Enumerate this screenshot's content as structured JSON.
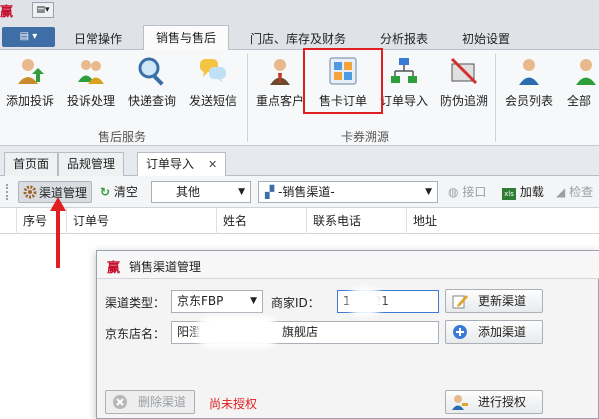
{
  "app": {
    "logo_text": "赢",
    "qat_glyph": "▤▾"
  },
  "ribbon_tabs": [
    "日常操作",
    "销售与售后",
    "门店、库存及财务",
    "分析报表",
    "初始设置"
  ],
  "ribbon_tab_active": "销售与售后",
  "ribbon": {
    "after_sales": {
      "caption": "售后服务",
      "buttons": [
        "添加投诉",
        "投诉处理",
        "快递查询",
        "发送短信"
      ]
    },
    "coupon": {
      "caption": "卡券溯源",
      "buttons": [
        "重点客户",
        "售卡订单",
        "订单导入",
        "防伪追溯"
      ]
    },
    "members": {
      "buttons": [
        "会员列表",
        "全部"
      ]
    }
  },
  "doc_tabs": {
    "items": [
      "首页面",
      "品规管理",
      "订单导入"
    ],
    "active": "订单导入",
    "close_glyph": "✕"
  },
  "toolbar": {
    "channel_mgmt": "渠道管理",
    "clear": "清空",
    "type_select": "其他",
    "channel_select": "-销售渠道-",
    "interface": "接口",
    "load": "加载",
    "check": "检查"
  },
  "grid": {
    "columns": [
      "序号",
      "订单号",
      "姓名",
      "联系电话",
      "地址"
    ]
  },
  "dialog": {
    "logo_text": "赢",
    "title": "销售渠道管理",
    "channel_type_label": "渠道类型：",
    "channel_type_value": "京东FBP",
    "merchant_id_label": "商家ID：",
    "merchant_id_value": "1      21",
    "store_name_label": "京东店名：",
    "store_name_value": "阳澄",
    "store_name_suffix": "旗舰店",
    "update_button": "更新渠道",
    "add_button": "添加渠道",
    "delete_button": "删除渠道",
    "unauthorized_text": "尚未授权",
    "authorize_button": "进行授权"
  },
  "colors": {
    "accent_red": "#e02020",
    "app_tab_blue": "#3f6ea6"
  }
}
